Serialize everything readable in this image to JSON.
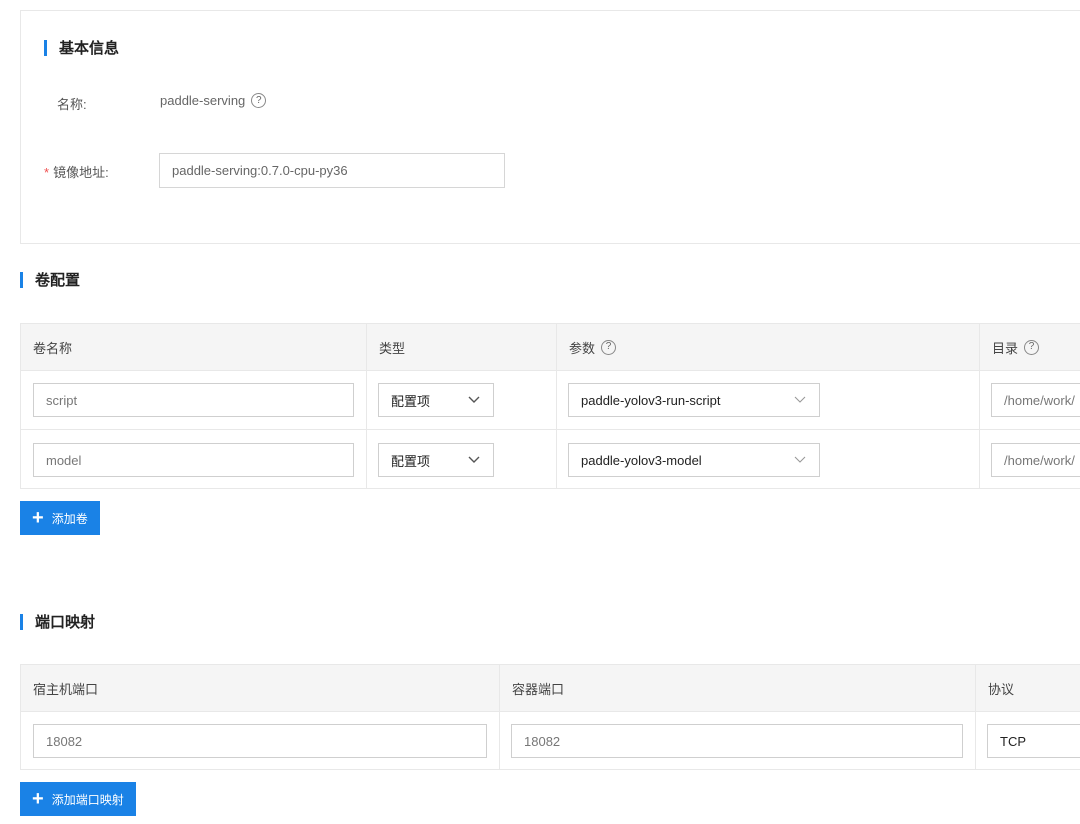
{
  "basic": {
    "title": "基本信息",
    "name_label": "名称:",
    "name_value": "paddle-serving",
    "image_label": "镜像地址:",
    "image_value": "paddle-serving:0.7.0-cpu-py36"
  },
  "volume": {
    "title": "卷配置",
    "headers": [
      "卷名称",
      "类型",
      "参数",
      "目录"
    ],
    "rows": [
      {
        "name": "script",
        "type": "配置项",
        "param": "paddle-yolov3-run-script",
        "dir": "/home/work/"
      },
      {
        "name": "model",
        "type": "配置项",
        "param": "paddle-yolov3-model",
        "dir": "/home/work/"
      }
    ],
    "add_button": "添加卷"
  },
  "ports": {
    "title": "端口映射",
    "headers": [
      "宿主机端口",
      "容器端口",
      "协议"
    ],
    "rows": [
      {
        "host": "18082",
        "container": "18082",
        "protocol": "TCP"
      }
    ],
    "add_button": "添加端口映射"
  },
  "colors": {
    "accent": "#1a82e6",
    "required": "#f05050"
  }
}
